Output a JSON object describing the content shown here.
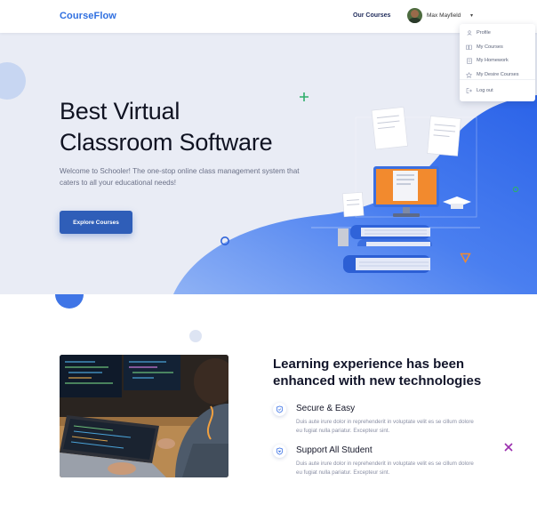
{
  "nav": {
    "logo": "CourseFlow",
    "our_courses": "Our Courses",
    "user_name": "Max Mayfield",
    "caret": "▾"
  },
  "user_menu": {
    "items": [
      {
        "label": "Profile",
        "icon": "user-icon"
      },
      {
        "label": "My Courses",
        "icon": "book-icon"
      },
      {
        "label": "My Homework",
        "icon": "homework-icon"
      },
      {
        "label": "My Desire Courses",
        "icon": "star-icon"
      },
      {
        "label": "Log out",
        "icon": "logout-icon"
      }
    ]
  },
  "hero": {
    "title_line1": "Best Virtual",
    "title_line2": "Classroom Software",
    "subtitle": "Welcome to Schooler! The one-stop online class management system that caters to all your educational needs!",
    "cta": "Explore Courses"
  },
  "features": {
    "title": "Learning experience has been enhanced with new technologies",
    "items": [
      {
        "title": "Secure & Easy",
        "desc": "Duis aute irure dolor in reprehenderit in voluptate velit es se cillum dolore eu fugiat nulla pariatur. Excepteur sint.",
        "icon": "shield-icon"
      },
      {
        "title": "Support All Student",
        "desc": "Duis aute irure dolor in reprehenderit in voluptate velit es se cillum dolore eu fugiat nulla pariatur. Excepteur sint.",
        "icon": "heart-shield-icon"
      }
    ]
  },
  "colors": {
    "primary": "#2f5eb8",
    "brand": "#2f6fe0",
    "hero_bg": "#e9ecf5",
    "accent_orange": "#f28a2e",
    "accent_green": "#2fae6b",
    "accent_purple": "#9b2fae"
  }
}
